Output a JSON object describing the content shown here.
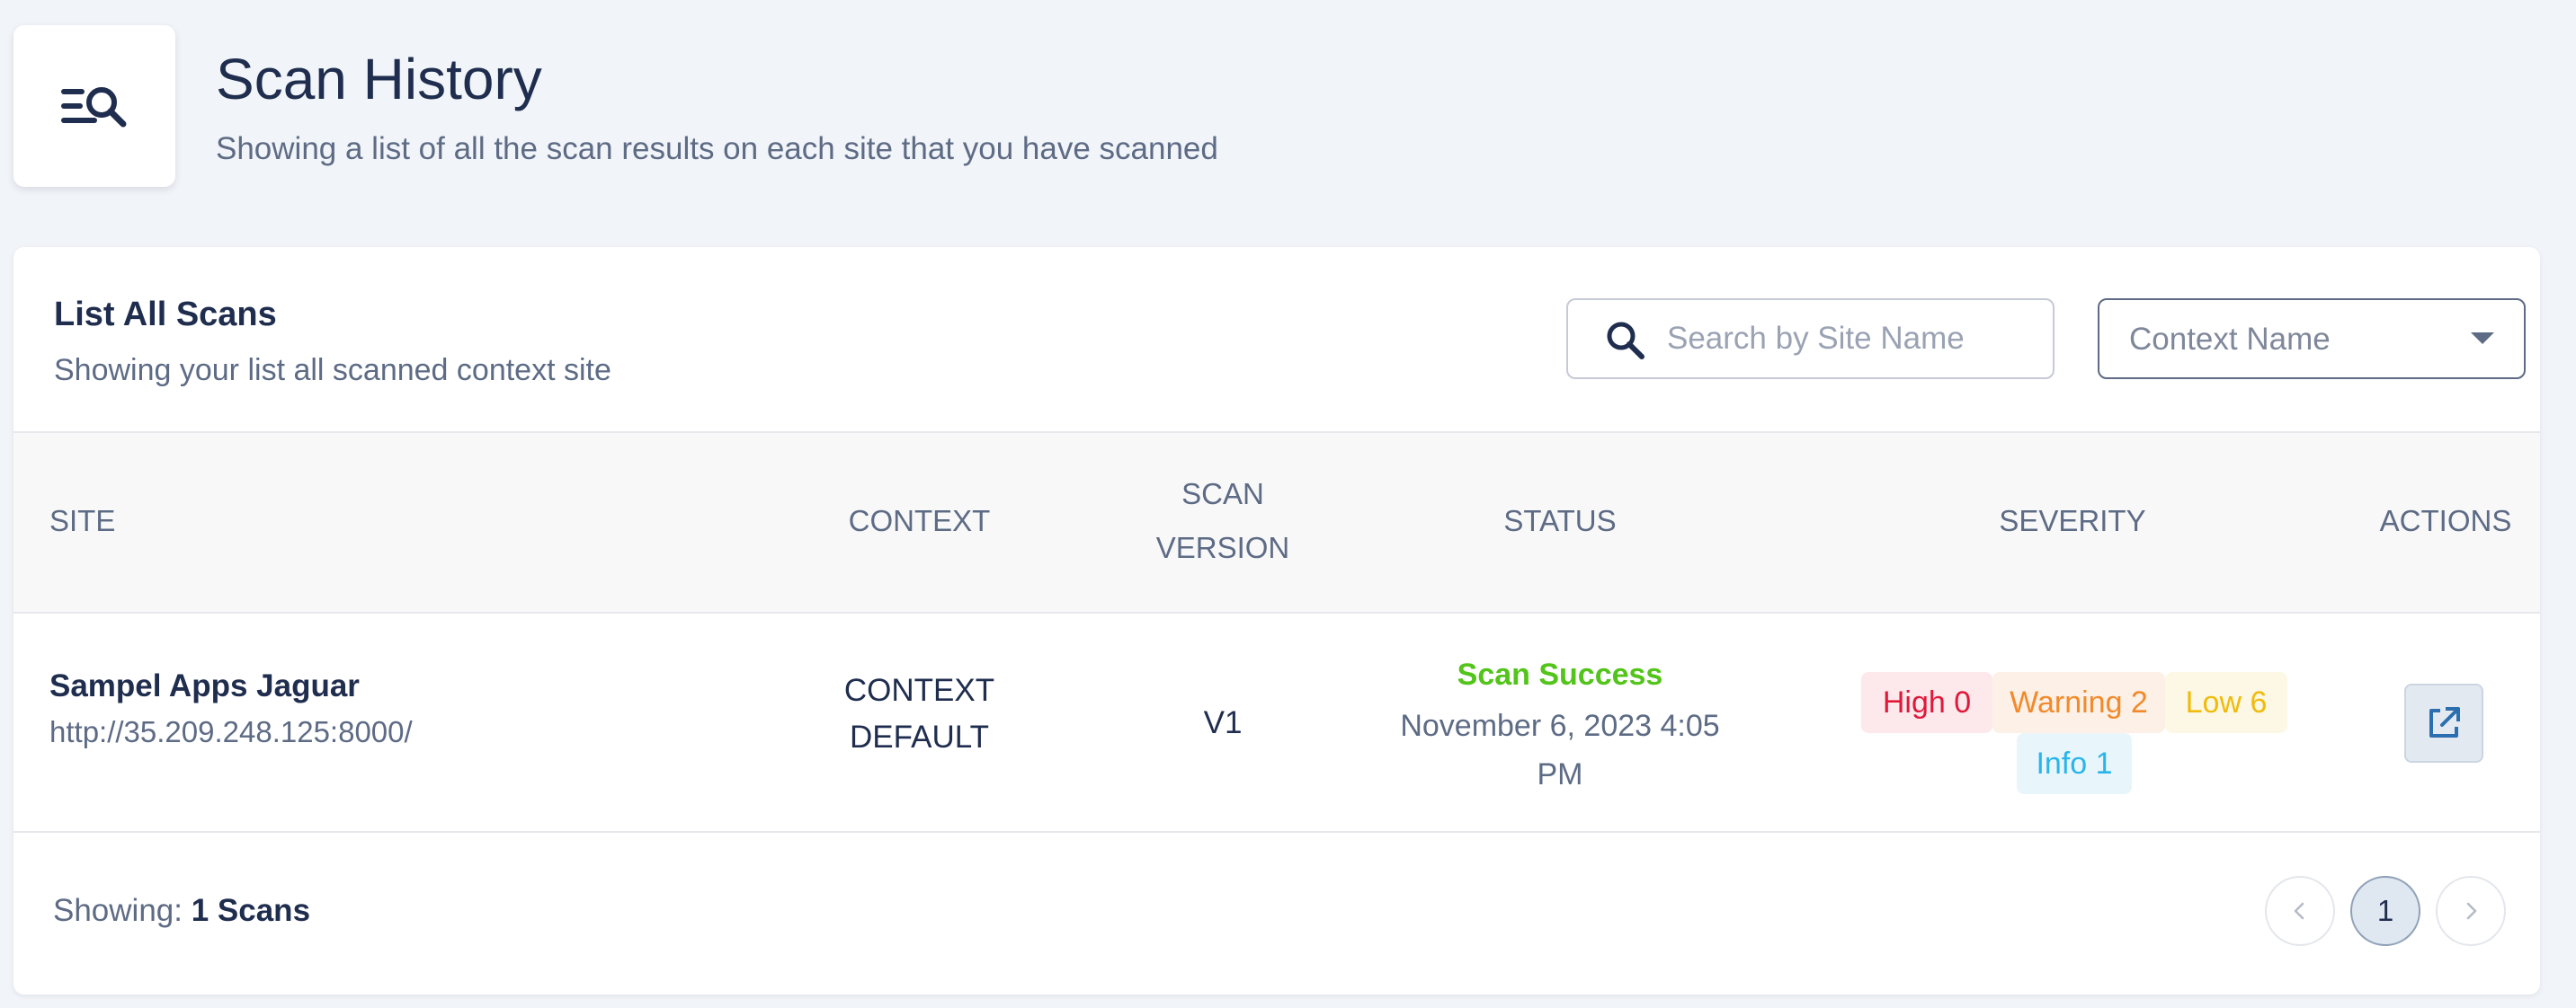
{
  "header": {
    "icon": "list-search-icon",
    "title": "Scan History",
    "subtitle": "Showing a list of all the scan results on each site that you have scanned"
  },
  "card": {
    "title": "List All Scans",
    "subtitle": "Showing your list all scanned context site",
    "search": {
      "icon": "search-icon",
      "placeholder": "Search by Site Name",
      "value": ""
    },
    "context_select": {
      "label": "Context Name",
      "icon": "chevron-down-icon"
    }
  },
  "table": {
    "columns": {
      "site": "SITE",
      "context": "CONTEXT",
      "scan_version": "SCAN VERSION",
      "status": "STATUS",
      "severity": "SEVERITY",
      "actions": "ACTIONS"
    },
    "rows": [
      {
        "site_name": "Sampel Apps Jaguar",
        "site_url": "http://35.209.248.125:8000/",
        "context": "CONTEXT DEFAULT",
        "scan_version": "V1",
        "status": "Scan Success",
        "date": "November 6, 2023 4:05 PM",
        "severity": {
          "high": "High 0",
          "warning": "Warning 2",
          "low": "Low 6",
          "info": "Info 1"
        },
        "action_icon": "external-link-icon"
      }
    ]
  },
  "footer": {
    "showing_label": "Showing:",
    "showing_count": "1 Scans",
    "pagination": {
      "prev_icon": "chevron-left-icon",
      "current_page": "1",
      "next_icon": "chevron-right-icon"
    }
  },
  "colors": {
    "background": "#f1f4f8",
    "text_primary": "#1f2d4e",
    "text_secondary": "#5d6b85",
    "status_success": "#52c41a",
    "severity_high": "#e0183a",
    "severity_warning": "#f28a2c",
    "severity_low": "#f0bb0b",
    "severity_info": "#2ab5ea"
  }
}
